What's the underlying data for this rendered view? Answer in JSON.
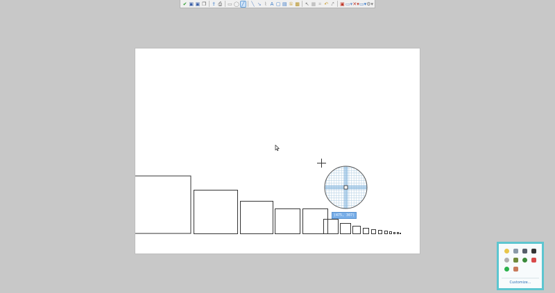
{
  "toolbar": {
    "tools": [
      {
        "icon": "checkmark-icon",
        "glyph": "✔",
        "color": "#2e9d2e"
      },
      {
        "icon": "save-icon",
        "glyph": "▣",
        "color": "#3a5fa8"
      },
      {
        "icon": "save-as-icon",
        "glyph": "▣",
        "color": "#3a5fa8"
      },
      {
        "icon": "copy-clipboard-icon",
        "glyph": "❐",
        "color": "#555555"
      },
      {
        "icon": "separator"
      },
      {
        "icon": "upload-icon",
        "glyph": "⇪",
        "color": "#3a7ac8"
      },
      {
        "icon": "print-icon",
        "glyph": "⎙",
        "color": "#444444"
      },
      {
        "icon": "separator"
      },
      {
        "icon": "select-rectangle-icon",
        "glyph": "▭",
        "color": "#888888"
      },
      {
        "icon": "ellipse-tool-icon",
        "glyph": "◯",
        "color": "#888888"
      },
      {
        "icon": "pen-tool-icon",
        "glyph": "╱",
        "color": "#3a7ac8",
        "selected": true
      },
      {
        "icon": "separator"
      },
      {
        "icon": "line-tool-icon",
        "glyph": "╲",
        "color": "#6a8fc8"
      },
      {
        "icon": "arrow-tool-icon",
        "glyph": "↘",
        "color": "#6a8fc8"
      },
      {
        "icon": "highlight-icon",
        "glyph": "⌇",
        "color": "#888888"
      },
      {
        "icon": "text-tool-icon",
        "glyph": "A",
        "color": "#3a7ac8"
      },
      {
        "icon": "speech-bubble-icon",
        "glyph": "▢",
        "color": "#3a7ac8"
      },
      {
        "icon": "callout-icon",
        "glyph": "▤",
        "color": "#3a7ac8"
      },
      {
        "icon": "step-label-icon",
        "glyph": "①",
        "color": "#c89a2a"
      },
      {
        "icon": "obfuscate-icon",
        "glyph": "▩",
        "color": "#b8942a"
      },
      {
        "icon": "separator"
      },
      {
        "icon": "pointer-icon",
        "glyph": "↖",
        "color": "#777777"
      },
      {
        "icon": "grid-icon",
        "glyph": "▦",
        "color": "#aaaaaa"
      },
      {
        "icon": "crop-icon",
        "glyph": "⌗",
        "color": "#aaaaaa"
      },
      {
        "icon": "undo-icon",
        "glyph": "↶",
        "color": "#c89a2a"
      },
      {
        "icon": "redo-icon",
        "glyph": "⤤",
        "color": "#888888"
      },
      {
        "icon": "separator"
      },
      {
        "icon": "delete-icon",
        "glyph": "▣",
        "color": "#c0392b"
      },
      {
        "icon": "export-dropdown-icon",
        "glyph": "▭▾",
        "color": "#6a8fc8"
      },
      {
        "icon": "close-dropdown-icon",
        "glyph": "✕▾",
        "color": "#c0392b"
      },
      {
        "icon": "image-dropdown-icon",
        "glyph": "▭▾",
        "color": "#3a7ac8"
      },
      {
        "icon": "settings-dropdown-icon",
        "glyph": "⚙▾",
        "color": "#777777"
      }
    ]
  },
  "canvas": {
    "squares": [
      82,
      63,
      47,
      36,
      36,
      21,
      15,
      11,
      8,
      6,
      5,
      4,
      3,
      2,
      2,
      1
    ]
  },
  "magnifier": {
    "coordinates": "(475, 307)",
    "grid_color": "#b9d3e6",
    "crosshair_color": "#7fb2dc"
  },
  "tray": {
    "icons": [
      {
        "name": "yellow-circle-icon",
        "color": "#e8c64a"
      },
      {
        "name": "shield-icon",
        "color": "#8a9aa8"
      },
      {
        "name": "monitor-icon",
        "color": "#555e6a"
      },
      {
        "name": "display-icon",
        "color": "#333333"
      },
      {
        "name": "gray-circle-icon",
        "color": "#b0b0b0"
      },
      {
        "name": "folder-sync-icon",
        "color": "#6f8a3a"
      },
      {
        "name": "chrome-icon",
        "color": "#3a8a3a"
      },
      {
        "name": "red-alert-icon",
        "color": "#d84a4a"
      },
      {
        "name": "green-status-icon",
        "color": "#2bb24c"
      },
      {
        "name": "network-icon",
        "color": "#c87a5a"
      }
    ],
    "customize_label": "Customize..."
  }
}
